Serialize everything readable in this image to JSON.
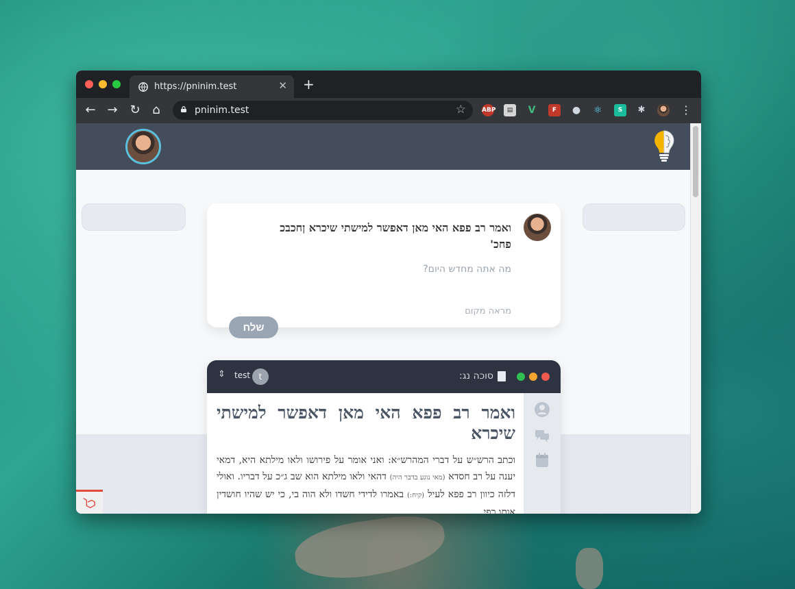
{
  "browser": {
    "tab_title": "https://pninim.test",
    "tab_close": "✕",
    "new_tab": "+",
    "address": "pninim.test",
    "extensions": [
      {
        "name": "abp-extension-icon",
        "label": "ABP",
        "color": "#c0392b"
      },
      {
        "name": "reader-extension-icon",
        "label": "▤",
        "color": "#d6d6d6"
      },
      {
        "name": "vue-devtools-icon",
        "label": "V",
        "color": "#41b883"
      },
      {
        "name": "f-extension-icon",
        "label": "F",
        "color": "#c0392b"
      },
      {
        "name": "face-extension-icon",
        "label": "●",
        "color": "#cfd6df"
      },
      {
        "name": "react-devtools-icon",
        "label": "⚛",
        "color": "#61dafb"
      },
      {
        "name": "s-extension-icon",
        "label": "S",
        "color": "#1abc9c"
      },
      {
        "name": "puzzle-extension-icon",
        "label": "✱",
        "color": "#cfd6df"
      }
    ]
  },
  "composer": {
    "text_line1": "ואמר רב פפא האי מאן דאפשר למישתי שיכרא ןחכבכ",
    "text_line2": "פחכ'",
    "placeholder": "מה אתה מחדש היום?",
    "location": "מראה מקום",
    "send_label": "שלח"
  },
  "post": {
    "book_title": "סוכה נג:",
    "user_initial": "t",
    "user_name": "test",
    "headline": "ואמר רב פפא האי מאן דאפשר למישתי שיכרא",
    "p1": "וכתב הרש״ש על דברי המהרש״א: ואני אומר על פירושו ולאו מילתא היא, דמאי יענה על רב חסדא",
    "p1_small": "(מאי נוגע בדבר היה)",
    "p2": "דהאי ולאו מילתא הוא שב ג״כ על דבריו. ואולי דלזה כיוון רב פפא לעיל",
    "p2_small": "(קיח:)",
    "p3": "באמרו לדידי חשדו ולא הוה בי, כי יש שהיו חושדין אותו כפי"
  },
  "colors": {
    "header_bg": "#434d5b",
    "post_header_bg": "#2d3340",
    "avatar_ring": "#5bc0de",
    "send_button": "#9aa5b4"
  }
}
